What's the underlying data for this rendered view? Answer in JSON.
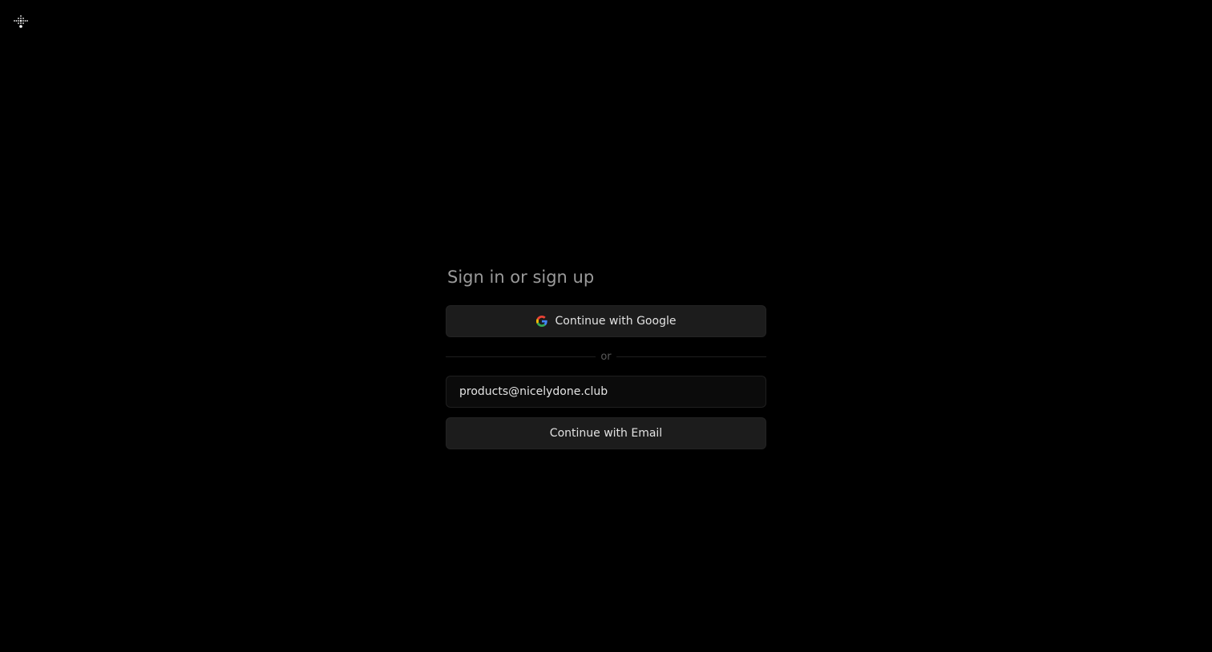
{
  "logo": {
    "icon": "dots-logo-icon"
  },
  "signin": {
    "title": "Sign in or sign up",
    "google_button_label": "Continue with Google",
    "divider_text": "or",
    "email_value": "products@nicelydone.club",
    "email_button_label": "Continue with Email"
  },
  "colors": {
    "background": "#000000",
    "button_bg": "#1c1c1c",
    "input_bg": "#0b0b0b",
    "title_text": "#9a9a9a",
    "google_blue": "#4285F4",
    "google_red": "#EA4335",
    "google_yellow": "#FBBC05",
    "google_green": "#34A853"
  }
}
